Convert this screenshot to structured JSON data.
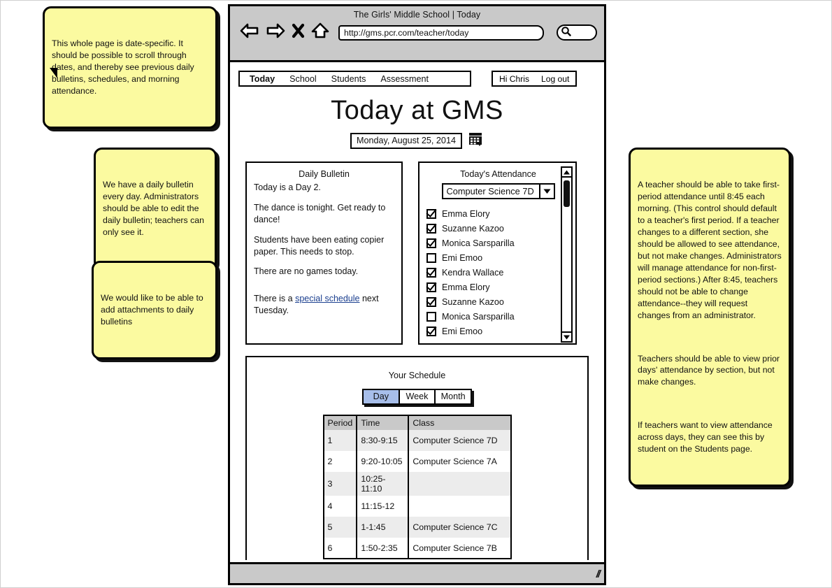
{
  "browser": {
    "window_title": "The Girls' Middle School | Today",
    "url": "http://gms.pcr.com/teacher/today",
    "back_icon": "back-arrow-icon",
    "forward_icon": "forward-arrow-icon",
    "stop_icon": "close-x-icon",
    "home_icon": "home-icon",
    "search_icon": "search-icon",
    "resize_grip": "//"
  },
  "nav": {
    "tabs": [
      {
        "label": "Today",
        "active": true
      },
      {
        "label": "School",
        "active": false
      },
      {
        "label": "Students",
        "active": false
      },
      {
        "label": "Assessment",
        "active": false
      }
    ],
    "greeting": "Hi Chris",
    "logout": "Log out"
  },
  "header": {
    "title": "Today at GMS",
    "date": "Monday, August 25, 2014",
    "calendar_icon": "calendar-icon"
  },
  "bulletin": {
    "heading": "Daily Bulletin",
    "paragraphs": [
      "Today is a Day 2.",
      "The dance is tonight. Get ready to dance!",
      "Students have been eating copier paper. This needs to stop.",
      "There are no games today."
    ],
    "link_sentence_before": "There is a ",
    "link_text": "special schedule",
    "link_sentence_after": " next Tuesday."
  },
  "attendance": {
    "heading": "Today's Attendance",
    "section_selected": "Computer Science 7D",
    "dropdown_icon": "chevron-down-icon",
    "scroll_up_icon": "scroll-up-arrow-icon",
    "scroll_down_icon": "scroll-down-arrow-icon",
    "students": [
      {
        "name": "Emma Elory",
        "present": true
      },
      {
        "name": "Suzanne Kazoo",
        "present": true
      },
      {
        "name": "Monica Sarsparilla",
        "present": true
      },
      {
        "name": "Emi Emoo",
        "present": false
      },
      {
        "name": "Kendra Wallace",
        "present": true
      },
      {
        "name": "Emma Elory",
        "present": true
      },
      {
        "name": "Suzanne Kazoo",
        "present": true
      },
      {
        "name": "Monica Sarsparilla",
        "present": false
      },
      {
        "name": "Emi Emoo",
        "present": true
      }
    ]
  },
  "schedule": {
    "heading": "Your Schedule",
    "views": [
      {
        "label": "Day",
        "selected": true
      },
      {
        "label": "Week",
        "selected": false
      },
      {
        "label": "Month",
        "selected": false
      }
    ],
    "columns": [
      "Period",
      "Time",
      "Class"
    ],
    "rows": [
      [
        "1",
        "8:30-9:15",
        "Computer Science 7D"
      ],
      [
        "2",
        "9:20-10:05",
        "Computer Science 7A"
      ],
      [
        "3",
        "10:25-11:10",
        ""
      ],
      [
        "4",
        "11:15-12",
        ""
      ],
      [
        "5",
        "1-1:45",
        "Computer Science 7C"
      ],
      [
        "6",
        "1:50-2:35",
        "Computer Science 7B"
      ]
    ]
  },
  "notes": {
    "top_left": "This whole page is date-specific. It should be possible to scroll through dates, and thereby see previous daily bulletins, schedules, and morning attendance.",
    "bulletin_note": "We have a daily bulletin every day. Administrators should be able to edit the daily bulletin; teachers can only see it.",
    "attachments_note": "We would like to be able to add attachments to daily bulletins",
    "attendance_note_p1": "A teacher should be able to take first-period attendance until 8:45 each morning. (This control should default to a teacher's first period. If a teacher changes to a different section, she should be allowed to see attendance, but not make changes. Administrators will manage attendance for non-first-period sections.) After 8:45, teachers should not be able to change attendance--they will request changes from an administrator.",
    "attendance_note_p2": "Teachers should be able to view prior days' attendance by section, but not make changes.",
    "attendance_note_p3": "If teachers want to view attendance across days, they can see this by student on the Students page."
  },
  "colors": {
    "note_yellow": "#fbfaa0",
    "chrome_gray": "#c9c9c9",
    "selected_blue": "#a7beea",
    "link_blue": "#1b3f8f",
    "row_alt": "#ececec"
  }
}
